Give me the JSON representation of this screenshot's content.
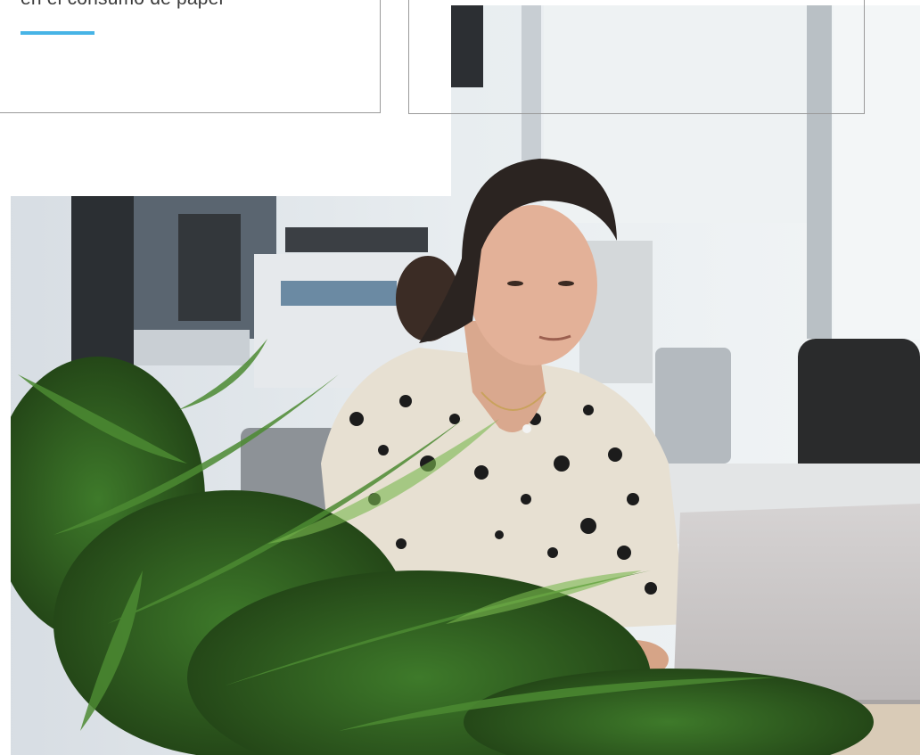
{
  "card_left": {
    "text": "en el consumo de paper",
    "accent_color": "#47b4e6"
  },
  "card_right": {
    "text": ""
  },
  "photo": {
    "icon": "photo-woman-laptop-office"
  }
}
